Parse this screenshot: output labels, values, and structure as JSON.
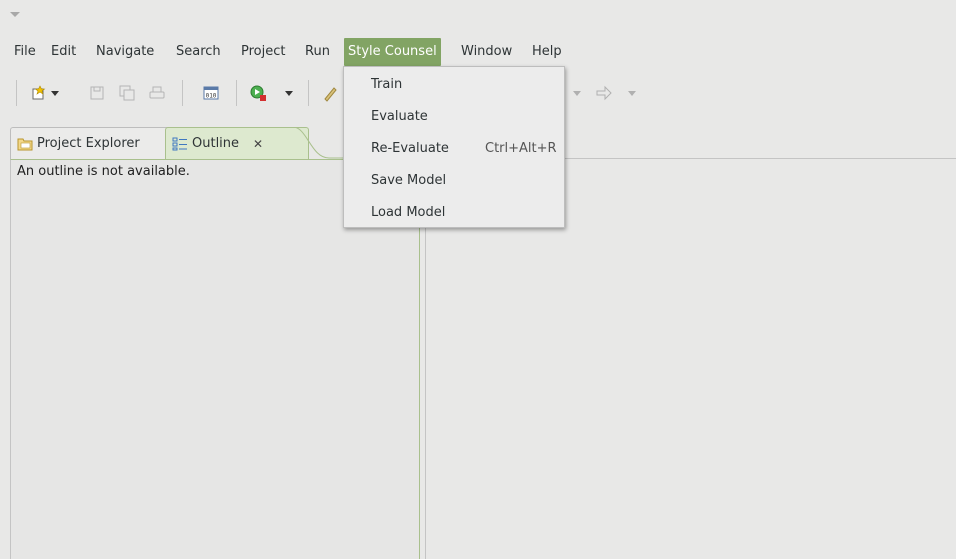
{
  "menubar": {
    "items": [
      "File",
      "Edit",
      "Navigate",
      "Search",
      "Project",
      "Run",
      "Style Counsel",
      "Window",
      "Help"
    ],
    "active_index": 6,
    "active_color": "#82a464"
  },
  "dropdown": {
    "items": [
      {
        "label": "Train",
        "shortcut": ""
      },
      {
        "label": "Evaluate",
        "shortcut": ""
      },
      {
        "label": "Re-Evaluate",
        "shortcut": "Ctrl+Alt+R"
      },
      {
        "label": "Save Model",
        "shortcut": ""
      },
      {
        "label": "Load Model",
        "shortcut": ""
      }
    ]
  },
  "toolbar": {
    "icons": [
      "new-wizard-icon",
      "save-icon",
      "save-all-icon",
      "print-icon",
      "binary-file-icon",
      "run-icon",
      "brush-icon",
      "next-edit-icon"
    ]
  },
  "left_panel": {
    "tabs": [
      {
        "label": "Project Explorer",
        "icon": "project-explorer-icon",
        "active": false
      },
      {
        "label": "Outline",
        "icon": "outline-icon",
        "active": true,
        "close": "✕"
      }
    ],
    "message": "An outline is not available."
  },
  "colors": {
    "accent": "#82a464",
    "active_tab_bg": "#dde9cf",
    "background": "#e8e8e7"
  }
}
